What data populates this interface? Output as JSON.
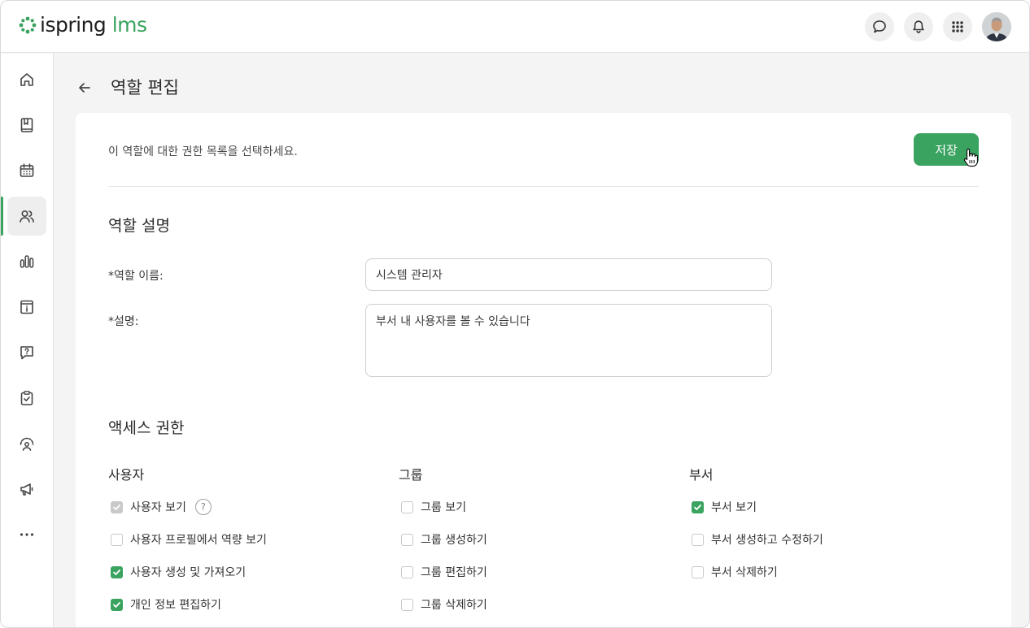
{
  "app": {
    "brand_main": "ispring",
    "brand_accent": "lms",
    "accent_color": "#3aa360"
  },
  "topbar": {
    "icons": [
      "chat-icon",
      "bell-icon",
      "apps-grid-icon",
      "user-avatar"
    ]
  },
  "sidebar": {
    "items": [
      {
        "name": "home-icon"
      },
      {
        "name": "book-icon"
      },
      {
        "name": "calendar-icon"
      },
      {
        "name": "users-icon",
        "active": true
      },
      {
        "name": "reports-icon"
      },
      {
        "name": "info-card-icon"
      },
      {
        "name": "question-chat-icon"
      },
      {
        "name": "clipboard-check-icon"
      },
      {
        "name": "gauge-icon"
      },
      {
        "name": "megaphone-icon"
      },
      {
        "name": "more-icon"
      }
    ]
  },
  "header": {
    "title": "역할 편집"
  },
  "card": {
    "intro": "이 역할에 대한 권한 목록을 선택하세요.",
    "save_label": "저장",
    "role_section_title": "역할 설명",
    "role_name_label": "*역할 이름:",
    "role_name_value": "시스템 관리자",
    "description_label": "*설명:",
    "description_value": "부서 내 사용자를 볼 수 있습니다",
    "access_section_title": "액세스 권한",
    "columns": [
      {
        "title": "사용자",
        "items": [
          {
            "label": "사용자 보기",
            "state": "disabled-checked",
            "help": true
          },
          {
            "label": "사용자 프로필에서 역량 보기",
            "state": "unchecked"
          },
          {
            "label": "사용자 생성 및 가져오기",
            "state": "checked"
          },
          {
            "label": "개인 정보 편집하기",
            "state": "checked"
          }
        ]
      },
      {
        "title": "그룹",
        "items": [
          {
            "label": "그룹 보기",
            "state": "unchecked"
          },
          {
            "label": "그룹 생성하기",
            "state": "unchecked"
          },
          {
            "label": "그룹 편집하기",
            "state": "unchecked"
          },
          {
            "label": "그룹 삭제하기",
            "state": "unchecked"
          }
        ]
      },
      {
        "title": "부서",
        "items": [
          {
            "label": "부서 보기",
            "state": "checked"
          },
          {
            "label": "부서 생성하고 수정하기",
            "state": "unchecked"
          },
          {
            "label": "부서 삭제하기",
            "state": "unchecked"
          }
        ]
      }
    ]
  }
}
